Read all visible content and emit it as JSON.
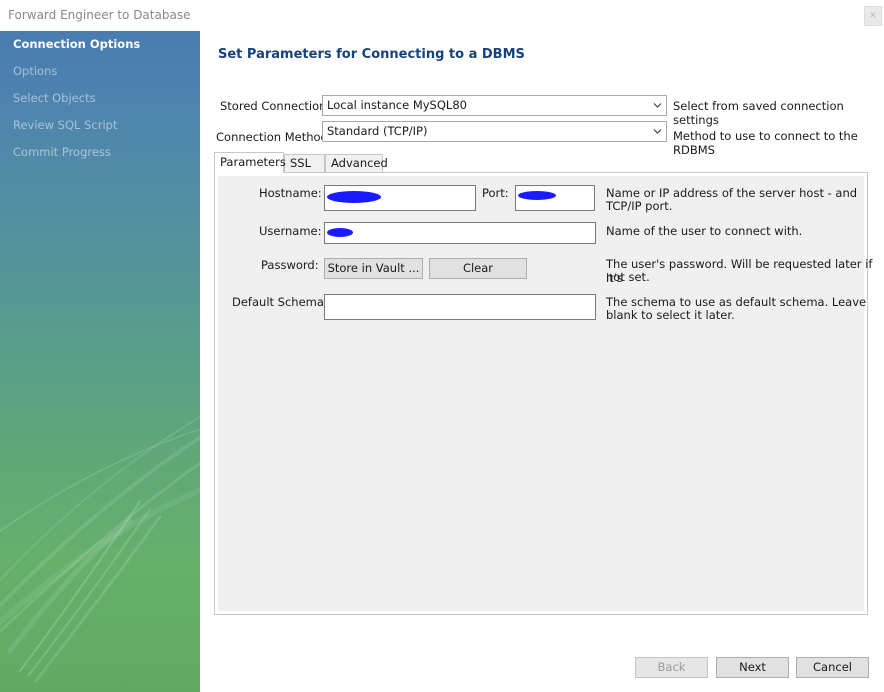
{
  "window": {
    "title": "Forward Engineer to Database"
  },
  "sidebar": {
    "items": [
      {
        "label": "Connection Options"
      },
      {
        "label": "Options"
      },
      {
        "label": "Select Objects"
      },
      {
        "label": "Review SQL Script"
      },
      {
        "label": "Commit Progress"
      }
    ],
    "active_index": 0
  },
  "main": {
    "heading": "Set Parameters for Connecting to a DBMS",
    "stored_connection": {
      "label": "Stored Connection:",
      "value": "Local instance MySQL80",
      "hint": "Select from saved connection settings"
    },
    "connection_method": {
      "label": "Connection Method:",
      "value": "Standard (TCP/IP)",
      "hint": "Method to use to connect to the RDBMS"
    },
    "tabs": [
      {
        "label": "Parameters"
      },
      {
        "label": "SSL"
      },
      {
        "label": "Advanced"
      }
    ],
    "active_tab": 0,
    "params": {
      "hostname_label": "Hostname:",
      "port_label": "Port:",
      "hostname_hint_1": "Name or IP address of the server host - and",
      "hostname_hint_2": "TCP/IP port.",
      "username_label": "Username:",
      "username_hint": "Name of the user to connect with.",
      "password_label": "Password:",
      "store_vault_label": "Store in Vault ...",
      "clear_label": "Clear",
      "password_hint_1": "The user's password. Will be requested later if it's",
      "password_hint_2": "not set.",
      "schema_label": "Default Schema:",
      "schema_value": "",
      "schema_hint_1": "The schema to use as default schema. Leave",
      "schema_hint_2": "blank to select it later."
    }
  },
  "footer": {
    "back_label": "Back",
    "next_label": "Next",
    "cancel_label": "Cancel"
  },
  "colors": {
    "heading": "#17437a",
    "redaction": "#1b1bff"
  }
}
